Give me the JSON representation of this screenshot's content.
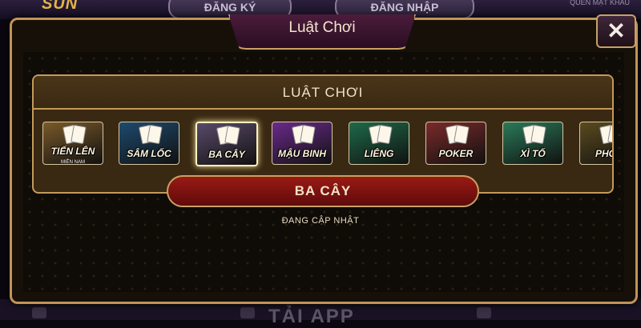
{
  "background": {
    "logo": "SUN",
    "register_label": "ĐĂNG KÝ",
    "login_label": "ĐĂNG NHẬP",
    "forgot_label": "QUÊN MẬT KHẨU",
    "bottom_label": "TẢI APP"
  },
  "modal": {
    "title": "Luật Chơi",
    "close_icon": "close-icon",
    "panel_title": "LUẬT CHƠI"
  },
  "games": [
    {
      "label": "TIẾN LÊN",
      "sub": "MIỀN NAM",
      "color": "#7a5a2a"
    },
    {
      "label": "SÂM LỐC",
      "sub": "",
      "color": "#1e4a6e"
    },
    {
      "label": "BA CÂY",
      "sub": "",
      "color": "#5a4a6a"
    },
    {
      "label": "MẬU BINH",
      "sub": "",
      "color": "#6a2a8a"
    },
    {
      "label": "LIÊNG",
      "sub": "",
      "color": "#1e6a4a"
    },
    {
      "label": "POKER",
      "sub": "",
      "color": "#7a2a2a"
    },
    {
      "label": "XÌ TỐ",
      "sub": "",
      "color": "#2a7a5a"
    },
    {
      "label": "PHỎM",
      "sub": "",
      "color": "#5a4a1e"
    }
  ],
  "selected_game": "BA CÂY",
  "status": "ĐANG CẬP NHẬT",
  "colors": {
    "accent_gold": "#c49a5a",
    "selected_bar_red": "#9a1a14"
  }
}
